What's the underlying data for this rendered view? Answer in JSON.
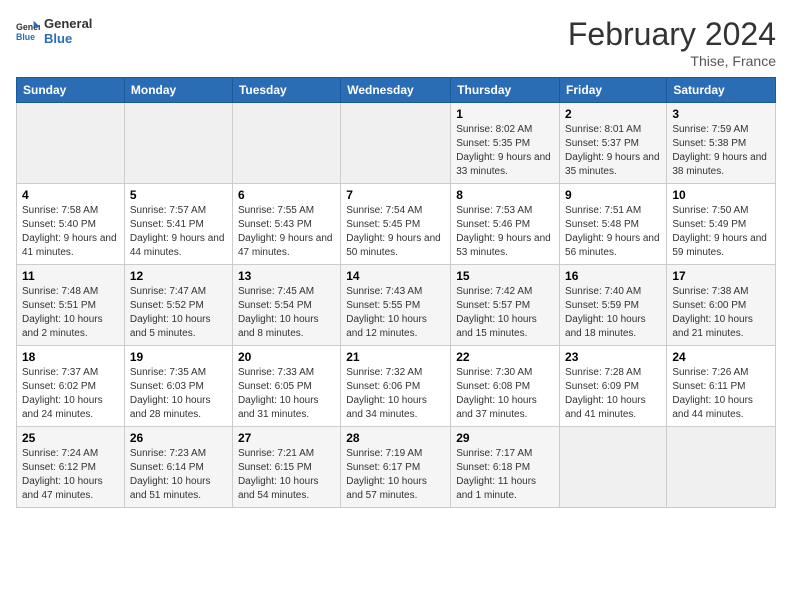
{
  "header": {
    "logo_line1": "General",
    "logo_line2": "Blue",
    "month_title": "February 2024",
    "location": "Thise, France"
  },
  "weekdays": [
    "Sunday",
    "Monday",
    "Tuesday",
    "Wednesday",
    "Thursday",
    "Friday",
    "Saturday"
  ],
  "weeks": [
    {
      "days": [
        {
          "num": "",
          "sunrise": "",
          "sunset": "",
          "daylight": "",
          "empty": true
        },
        {
          "num": "",
          "sunrise": "",
          "sunset": "",
          "daylight": "",
          "empty": true
        },
        {
          "num": "",
          "sunrise": "",
          "sunset": "",
          "daylight": "",
          "empty": true
        },
        {
          "num": "",
          "sunrise": "",
          "sunset": "",
          "daylight": "",
          "empty": true
        },
        {
          "num": "1",
          "sunrise": "Sunrise: 8:02 AM",
          "sunset": "Sunset: 5:35 PM",
          "daylight": "Daylight: 9 hours and 33 minutes.",
          "empty": false
        },
        {
          "num": "2",
          "sunrise": "Sunrise: 8:01 AM",
          "sunset": "Sunset: 5:37 PM",
          "daylight": "Daylight: 9 hours and 35 minutes.",
          "empty": false
        },
        {
          "num": "3",
          "sunrise": "Sunrise: 7:59 AM",
          "sunset": "Sunset: 5:38 PM",
          "daylight": "Daylight: 9 hours and 38 minutes.",
          "empty": false
        }
      ]
    },
    {
      "days": [
        {
          "num": "4",
          "sunrise": "Sunrise: 7:58 AM",
          "sunset": "Sunset: 5:40 PM",
          "daylight": "Daylight: 9 hours and 41 minutes.",
          "empty": false
        },
        {
          "num": "5",
          "sunrise": "Sunrise: 7:57 AM",
          "sunset": "Sunset: 5:41 PM",
          "daylight": "Daylight: 9 hours and 44 minutes.",
          "empty": false
        },
        {
          "num": "6",
          "sunrise": "Sunrise: 7:55 AM",
          "sunset": "Sunset: 5:43 PM",
          "daylight": "Daylight: 9 hours and 47 minutes.",
          "empty": false
        },
        {
          "num": "7",
          "sunrise": "Sunrise: 7:54 AM",
          "sunset": "Sunset: 5:45 PM",
          "daylight": "Daylight: 9 hours and 50 minutes.",
          "empty": false
        },
        {
          "num": "8",
          "sunrise": "Sunrise: 7:53 AM",
          "sunset": "Sunset: 5:46 PM",
          "daylight": "Daylight: 9 hours and 53 minutes.",
          "empty": false
        },
        {
          "num": "9",
          "sunrise": "Sunrise: 7:51 AM",
          "sunset": "Sunset: 5:48 PM",
          "daylight": "Daylight: 9 hours and 56 minutes.",
          "empty": false
        },
        {
          "num": "10",
          "sunrise": "Sunrise: 7:50 AM",
          "sunset": "Sunset: 5:49 PM",
          "daylight": "Daylight: 9 hours and 59 minutes.",
          "empty": false
        }
      ]
    },
    {
      "days": [
        {
          "num": "11",
          "sunrise": "Sunrise: 7:48 AM",
          "sunset": "Sunset: 5:51 PM",
          "daylight": "Daylight: 10 hours and 2 minutes.",
          "empty": false
        },
        {
          "num": "12",
          "sunrise": "Sunrise: 7:47 AM",
          "sunset": "Sunset: 5:52 PM",
          "daylight": "Daylight: 10 hours and 5 minutes.",
          "empty": false
        },
        {
          "num": "13",
          "sunrise": "Sunrise: 7:45 AM",
          "sunset": "Sunset: 5:54 PM",
          "daylight": "Daylight: 10 hours and 8 minutes.",
          "empty": false
        },
        {
          "num": "14",
          "sunrise": "Sunrise: 7:43 AM",
          "sunset": "Sunset: 5:55 PM",
          "daylight": "Daylight: 10 hours and 12 minutes.",
          "empty": false
        },
        {
          "num": "15",
          "sunrise": "Sunrise: 7:42 AM",
          "sunset": "Sunset: 5:57 PM",
          "daylight": "Daylight: 10 hours and 15 minutes.",
          "empty": false
        },
        {
          "num": "16",
          "sunrise": "Sunrise: 7:40 AM",
          "sunset": "Sunset: 5:59 PM",
          "daylight": "Daylight: 10 hours and 18 minutes.",
          "empty": false
        },
        {
          "num": "17",
          "sunrise": "Sunrise: 7:38 AM",
          "sunset": "Sunset: 6:00 PM",
          "daylight": "Daylight: 10 hours and 21 minutes.",
          "empty": false
        }
      ]
    },
    {
      "days": [
        {
          "num": "18",
          "sunrise": "Sunrise: 7:37 AM",
          "sunset": "Sunset: 6:02 PM",
          "daylight": "Daylight: 10 hours and 24 minutes.",
          "empty": false
        },
        {
          "num": "19",
          "sunrise": "Sunrise: 7:35 AM",
          "sunset": "Sunset: 6:03 PM",
          "daylight": "Daylight: 10 hours and 28 minutes.",
          "empty": false
        },
        {
          "num": "20",
          "sunrise": "Sunrise: 7:33 AM",
          "sunset": "Sunset: 6:05 PM",
          "daylight": "Daylight: 10 hours and 31 minutes.",
          "empty": false
        },
        {
          "num": "21",
          "sunrise": "Sunrise: 7:32 AM",
          "sunset": "Sunset: 6:06 PM",
          "daylight": "Daylight: 10 hours and 34 minutes.",
          "empty": false
        },
        {
          "num": "22",
          "sunrise": "Sunrise: 7:30 AM",
          "sunset": "Sunset: 6:08 PM",
          "daylight": "Daylight: 10 hours and 37 minutes.",
          "empty": false
        },
        {
          "num": "23",
          "sunrise": "Sunrise: 7:28 AM",
          "sunset": "Sunset: 6:09 PM",
          "daylight": "Daylight: 10 hours and 41 minutes.",
          "empty": false
        },
        {
          "num": "24",
          "sunrise": "Sunrise: 7:26 AM",
          "sunset": "Sunset: 6:11 PM",
          "daylight": "Daylight: 10 hours and 44 minutes.",
          "empty": false
        }
      ]
    },
    {
      "days": [
        {
          "num": "25",
          "sunrise": "Sunrise: 7:24 AM",
          "sunset": "Sunset: 6:12 PM",
          "daylight": "Daylight: 10 hours and 47 minutes.",
          "empty": false
        },
        {
          "num": "26",
          "sunrise": "Sunrise: 7:23 AM",
          "sunset": "Sunset: 6:14 PM",
          "daylight": "Daylight: 10 hours and 51 minutes.",
          "empty": false
        },
        {
          "num": "27",
          "sunrise": "Sunrise: 7:21 AM",
          "sunset": "Sunset: 6:15 PM",
          "daylight": "Daylight: 10 hours and 54 minutes.",
          "empty": false
        },
        {
          "num": "28",
          "sunrise": "Sunrise: 7:19 AM",
          "sunset": "Sunset: 6:17 PM",
          "daylight": "Daylight: 10 hours and 57 minutes.",
          "empty": false
        },
        {
          "num": "29",
          "sunrise": "Sunrise: 7:17 AM",
          "sunset": "Sunset: 6:18 PM",
          "daylight": "Daylight: 11 hours and 1 minute.",
          "empty": false
        },
        {
          "num": "",
          "sunrise": "",
          "sunset": "",
          "daylight": "",
          "empty": true
        },
        {
          "num": "",
          "sunrise": "",
          "sunset": "",
          "daylight": "",
          "empty": true
        }
      ]
    }
  ]
}
